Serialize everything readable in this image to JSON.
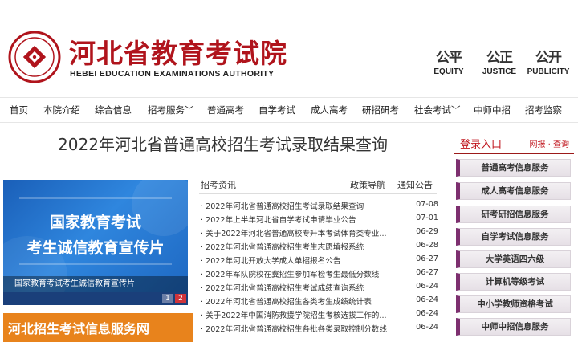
{
  "header": {
    "title_cn": "河北省教育考试院",
    "title_en": "HEBEI EDUCATION EXAMINATIONS AUTHORITY",
    "seal_icon": "authority-seal-icon",
    "motto": [
      {
        "glyph": "公平",
        "en": "EQUITY"
      },
      {
        "glyph": "公正",
        "en": "JUSTICE"
      },
      {
        "glyph": "公开",
        "en": "PUBLICITY"
      }
    ]
  },
  "nav": {
    "items": [
      {
        "label": "首页"
      },
      {
        "label": "本院介绍"
      },
      {
        "label": "综合信息"
      },
      {
        "label": "招考服务﹀"
      },
      {
        "label": "普通高考"
      },
      {
        "label": "自学考试"
      },
      {
        "label": "成人高考"
      },
      {
        "label": "研招研考"
      },
      {
        "label": "社会考试﹀"
      },
      {
        "label": "中师中招"
      },
      {
        "label": "招考监察"
      }
    ]
  },
  "main": {
    "page_title": "2022年河北省普通高校招生考试录取结果查询"
  },
  "banner": {
    "line1": "国家教育考试",
    "line2": "考生诚信教育宣传片",
    "caption": "国家教育考试考生诚信教育宣传片",
    "pages": [
      "1",
      "2"
    ],
    "active_page": "2"
  },
  "strip": {
    "label": "河北招生考试信息服务网"
  },
  "news": {
    "tabs": [
      "招考资讯",
      "政策导航",
      "通知公告"
    ],
    "items": [
      {
        "title": "· 2022年河北省普通高校招生考试录取结果查询",
        "date": "07-08"
      },
      {
        "title": "· 2022年上半年河北省自学考试申请毕业公告",
        "date": "07-01"
      },
      {
        "title": "· 关于2022年河北省普通高校专升本考试体育类专业...",
        "date": "06-29"
      },
      {
        "title": "· 2022年河北省普通高校招生考生志愿填报系统",
        "date": "06-28"
      },
      {
        "title": "· 2022年河北开放大学成人单招报名公告",
        "date": "06-27"
      },
      {
        "title": "· 2022年军队院校在冀招生参加军检考生最低分数线",
        "date": "06-27"
      },
      {
        "title": "· 2022年河北省普通高校招生考试成绩查询系统",
        "date": "06-24"
      },
      {
        "title": "· 2022年河北省普通高校招生各类考生成绩统计表",
        "date": "06-24"
      },
      {
        "title": "· 关于2022年中国消防救援学院招生考核选拔工作的...",
        "date": "06-24"
      },
      {
        "title": "· 2022年河北省普通高校招生各批各类录取控制分数线",
        "date": "06-24"
      }
    ]
  },
  "sidebar": {
    "login_label": "登录入口",
    "login_links": "网报 · 查询",
    "services": [
      "普通高考信息服务",
      "成人高考信息服务",
      "研考研招信息服务",
      "自学考试信息服务",
      "大学英语四六级",
      "计算机等级考试",
      "中小学教师资格考试",
      "中师中招信息服务"
    ]
  }
}
